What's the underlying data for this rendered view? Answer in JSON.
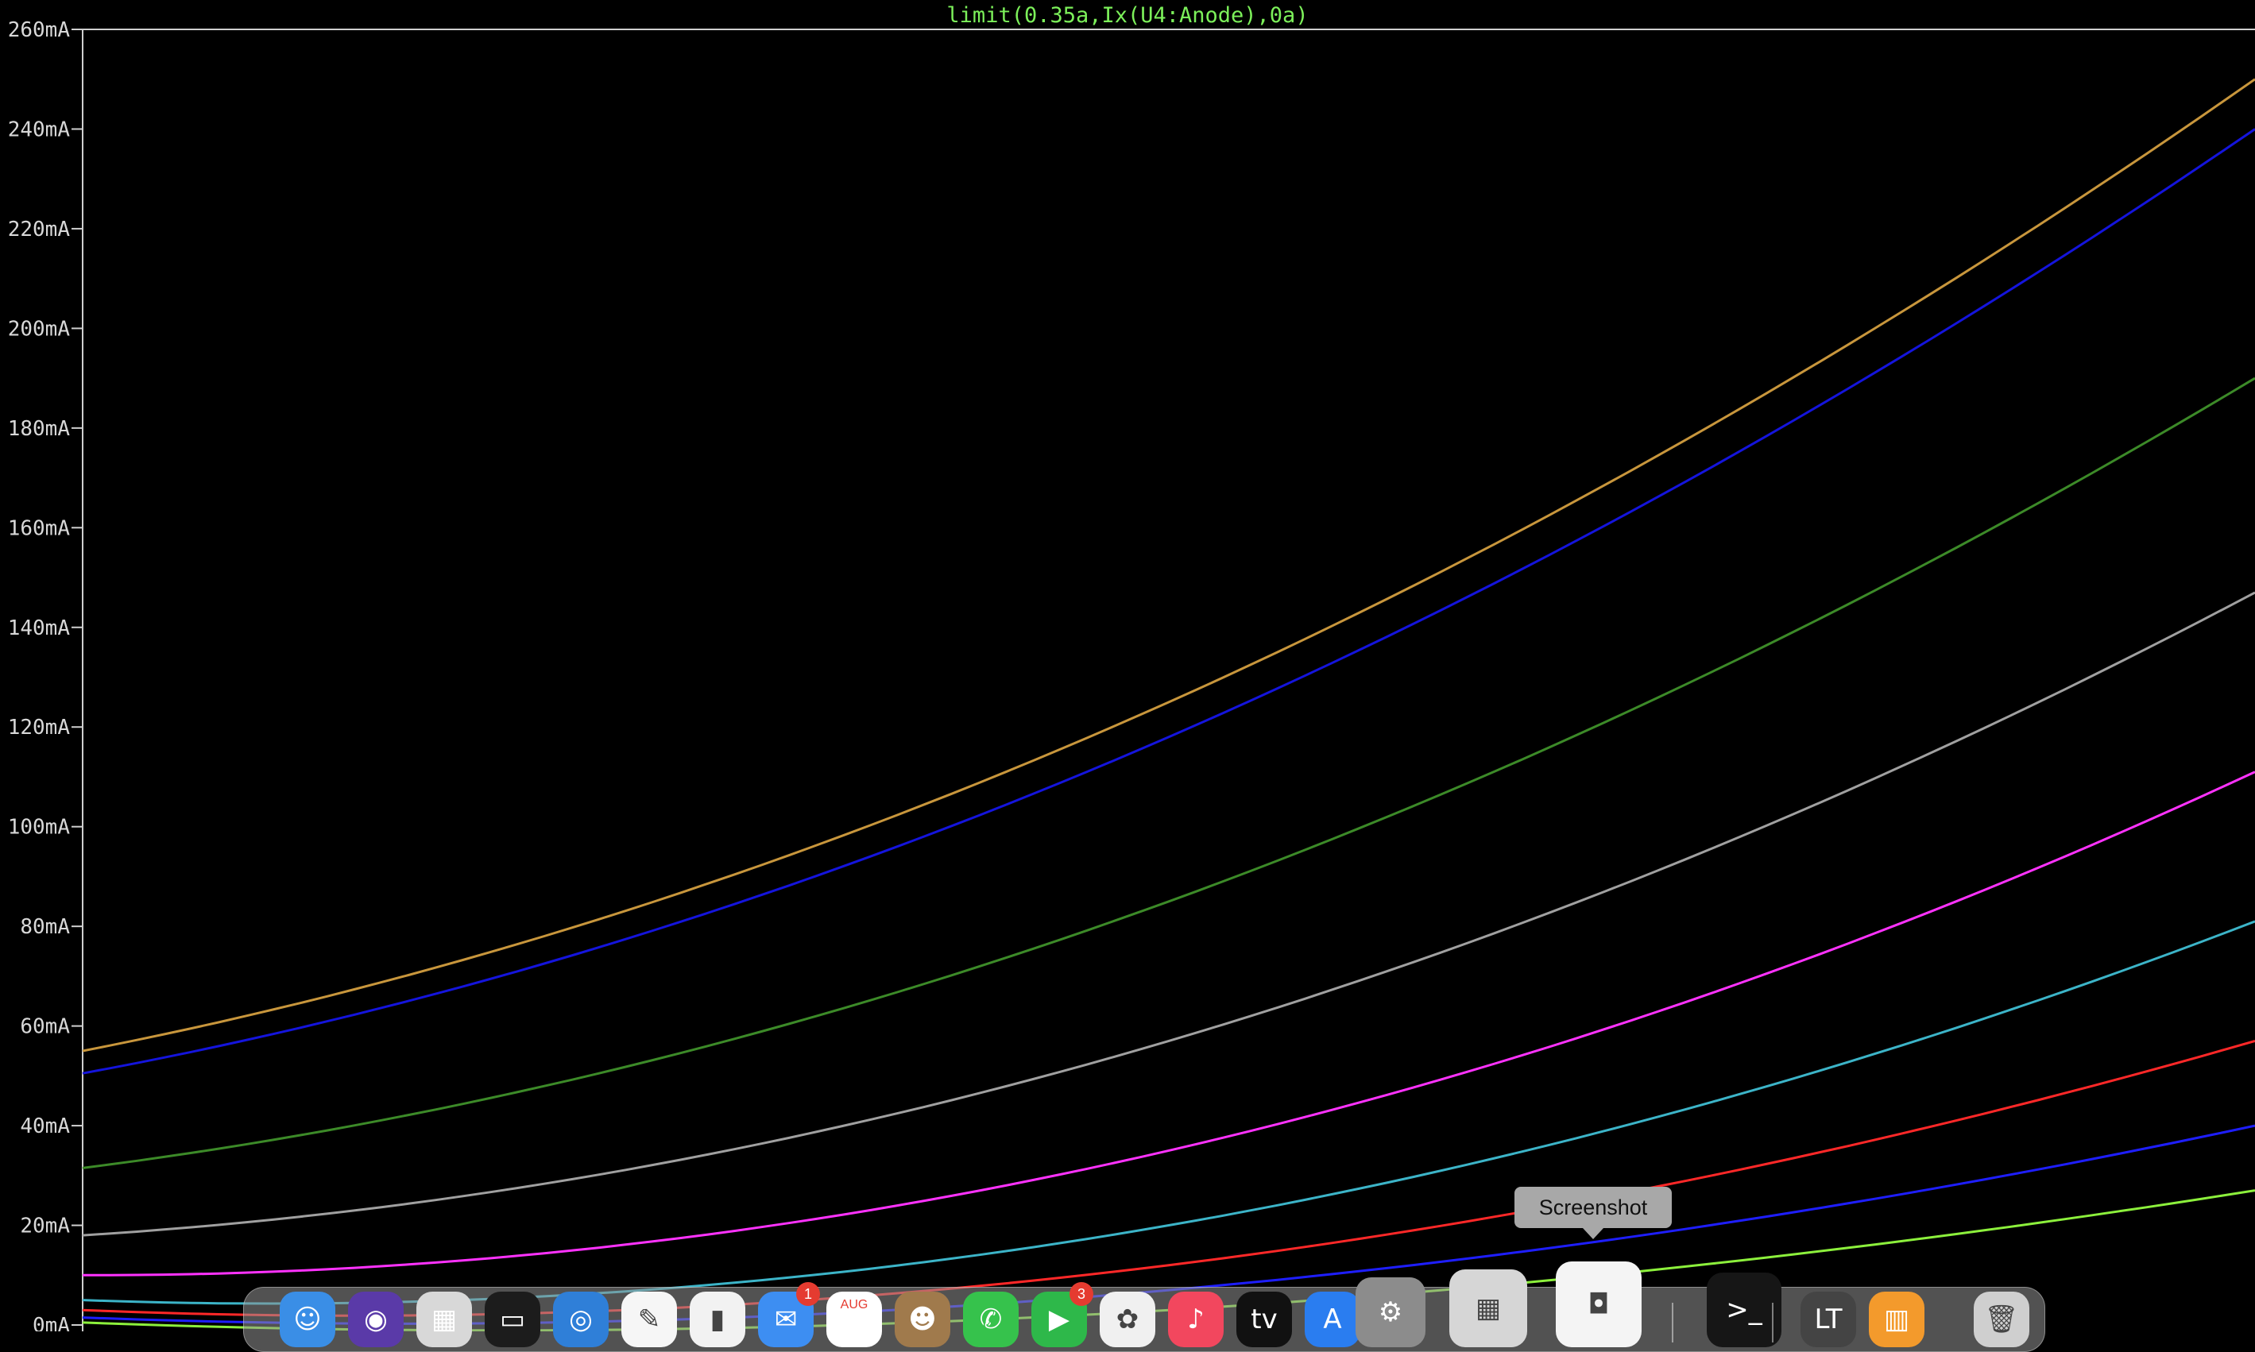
{
  "window": {
    "trace_expression": "limit(0.35a,Ix(U4:Anode),0a)"
  },
  "chart_data": {
    "type": "line",
    "title": "limit(0.35a,Ix(U4:Anode),0a)",
    "xlabel": "",
    "ylabel": "",
    "ylim": [
      0,
      260
    ],
    "y_unit": "mA",
    "y_ticks": [
      "0mA",
      "20mA",
      "40mA",
      "60mA",
      "80mA",
      "100mA",
      "120mA",
      "140mA",
      "160mA",
      "180mA",
      "200mA",
      "220mA",
      "240mA",
      "260mA"
    ],
    "x_ticks": [],
    "grid": false,
    "background": "#000000",
    "series": [
      {
        "color": "#c8963c",
        "x": [
          0,
          0.5,
          1
        ],
        "y": [
          55,
          125,
          250
        ]
      },
      {
        "color": "#1414dc",
        "x": [
          0,
          0.5,
          1
        ],
        "y": [
          50.5,
          118,
          240
        ]
      },
      {
        "color": "#3c8a28",
        "x": [
          0,
          0.5,
          1
        ],
        "y": [
          31.5,
          85,
          190
        ]
      },
      {
        "color": "#a0a0a0",
        "x": [
          0,
          0.5,
          1
        ],
        "y": [
          18,
          57,
          147
        ]
      },
      {
        "color": "#ff32ff",
        "x": [
          0,
          0.5,
          1
        ],
        "y": [
          10,
          35,
          111
        ]
      },
      {
        "color": "#3cb4c8",
        "x": [
          0,
          0.5,
          1
        ],
        "y": [
          5,
          20,
          81
        ]
      },
      {
        "color": "#ff2828",
        "x": [
          0,
          0.5,
          1
        ],
        "y": [
          3,
          12,
          57
        ]
      },
      {
        "color": "#1e1eff",
        "x": [
          0,
          0.5,
          1
        ],
        "y": [
          1.5,
          7,
          40
        ]
      },
      {
        "color": "#8cf03c",
        "x": [
          0,
          0.5,
          1
        ],
        "y": [
          0.5,
          3,
          27
        ]
      }
    ]
  },
  "tooltip": {
    "text": "Screenshot"
  },
  "dock": {
    "items": [
      {
        "icon": "finder-icon",
        "glyph": "☺",
        "color": "#3a8ee6"
      },
      {
        "icon": "siri-icon",
        "glyph": "◉",
        "color": "#5a3aa8"
      },
      {
        "icon": "launchpad-icon",
        "glyph": "▦",
        "color": "#d8d8d8"
      },
      {
        "icon": "mission-control-icon",
        "glyph": "▭",
        "color": "#1c1c1c"
      },
      {
        "icon": "safari-icon",
        "glyph": "◎",
        "color": "#2f7fd8"
      },
      {
        "icon": "pages-icon",
        "glyph": "✎",
        "color": "#f6f6f6"
      },
      {
        "icon": "numbers-icon",
        "glyph": "▮",
        "color": "#f2f2f2"
      },
      {
        "icon": "mail-icon",
        "glyph": "✉",
        "color": "#3d8ef2",
        "badge": "1"
      },
      {
        "icon": "calendar-icon",
        "glyph": "",
        "color": "#ffffff",
        "month": "AUG"
      },
      {
        "icon": "contacts-icon",
        "glyph": "☻",
        "color": "#a07a4c"
      },
      {
        "icon": "messages-icon",
        "glyph": "✆",
        "color": "#36c24c"
      },
      {
        "icon": "facetime-icon",
        "glyph": "▶",
        "color": "#2eb84a",
        "badge": "3"
      },
      {
        "icon": "photos-icon",
        "glyph": "✿",
        "color": "#f0f0f0"
      },
      {
        "icon": "music-icon",
        "glyph": "♪",
        "color": "#f2475e"
      },
      {
        "icon": "apple-tv-icon",
        "glyph": "",
        "color": "#111111",
        "label": "tv"
      },
      {
        "icon": "app-store-icon",
        "glyph": "A",
        "color": "#2a7df0"
      },
      {
        "icon": "system-preferences-icon",
        "glyph": "⚙",
        "color": "#8c8c8c"
      },
      {
        "icon": "calculator-icon",
        "glyph": "▦",
        "color": "#d6d6d6"
      },
      {
        "icon": "screenshot-icon",
        "glyph": "◘",
        "color": "#f4f4f4"
      },
      {
        "icon": "terminal-icon",
        "glyph": ">_",
        "color": "#161616"
      },
      {
        "icon": "ltspice-icon",
        "glyph": "LT",
        "color": "#444444"
      },
      {
        "icon": "books-icon",
        "glyph": "▥",
        "color": "#f39a2c"
      },
      {
        "icon": "trash-icon",
        "glyph": "🗑",
        "color": "#cfcfcf"
      }
    ]
  }
}
